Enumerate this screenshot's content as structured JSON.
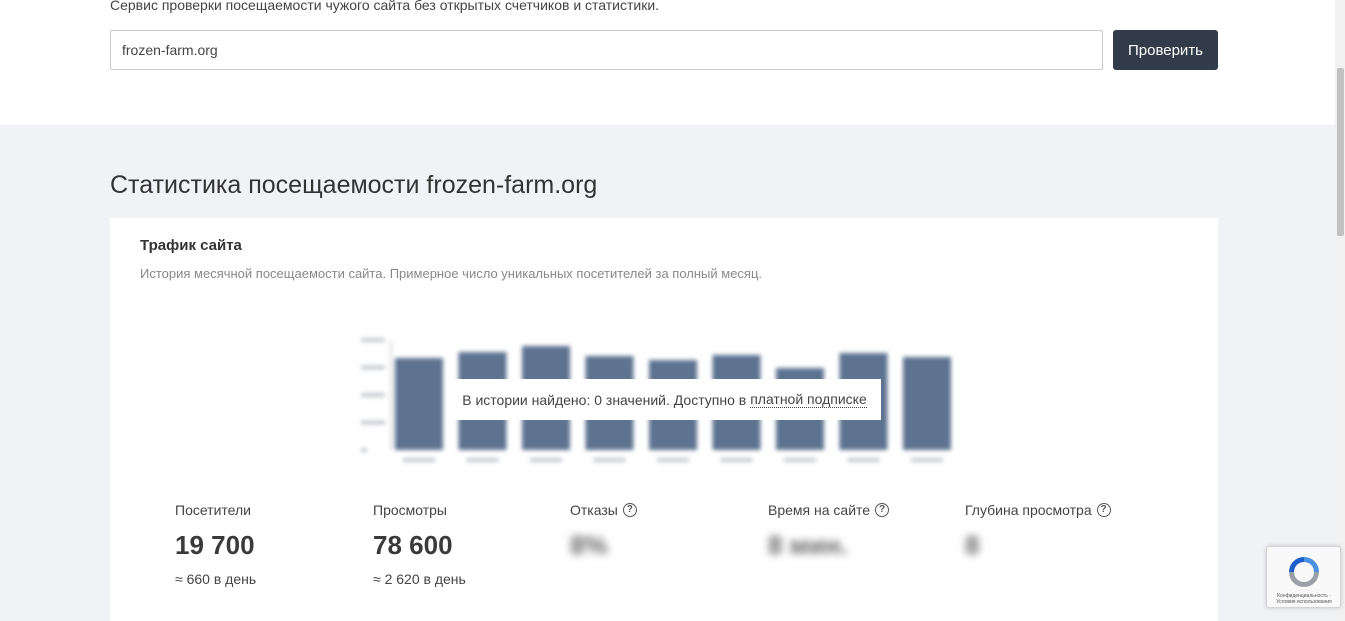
{
  "header": {
    "tagline": "Сервис проверки посещаемости чужого сайта без открытых счетчиков и статистики.",
    "search_value": "frozen-farm.org",
    "check_label": "Проверить"
  },
  "page_title": "Статистика посещаемости frozen-farm.org",
  "traffic": {
    "title": "Трафик сайта",
    "description": "История месячной посещаемости сайта. Примерное число уникальных посетителей за полный месяц.",
    "overlay_text": "В истории найдено: 0 значений. Доступно в",
    "overlay_link": "платной подписке"
  },
  "chart_data": {
    "type": "bar",
    "values": [
      92,
      98,
      104,
      94,
      90,
      95,
      82,
      97,
      93
    ],
    "ylim": [
      0,
      110
    ],
    "blurred": true,
    "bar_color": "#5e7390"
  },
  "metrics": [
    {
      "label": "Посетители",
      "value": "19 700",
      "sub": "≈ 660 в день",
      "help": false,
      "blurred": false
    },
    {
      "label": "Просмотры",
      "value": "78 600",
      "sub": "≈ 2 620 в день",
      "help": false,
      "blurred": false
    },
    {
      "label": "Отказы",
      "value": "8%",
      "sub": "",
      "help": true,
      "blurred": true
    },
    {
      "label": "Время на сайте",
      "value": "8 мин.",
      "sub": "",
      "help": true,
      "blurred": true
    },
    {
      "label": "Глубина просмотра",
      "value": "8",
      "sub": "",
      "help": true,
      "blurred": true
    }
  ],
  "colors": {
    "accent_button": "#313b4a",
    "background": "#f1f2f6"
  }
}
